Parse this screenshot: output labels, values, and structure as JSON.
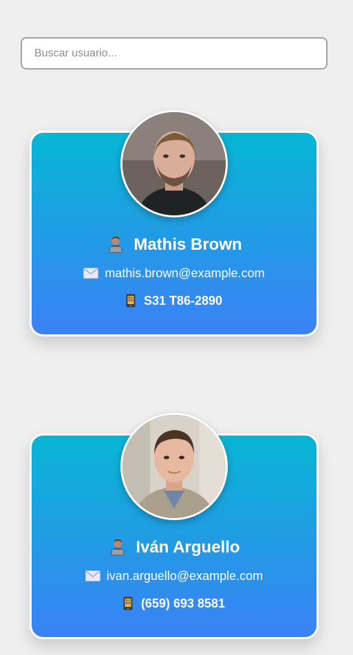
{
  "search": {
    "placeholder": "Buscar usuario..."
  },
  "users": [
    {
      "name": "Mathis Brown",
      "email": "mathis.brown@example.com",
      "phone": "S31 T86-2890",
      "name_icon": "person-at-laptop-icon",
      "email_icon": "envelope-icon",
      "phone_icon": "mobile-phone-icon"
    },
    {
      "name": "Iván Arguello",
      "email": "ivan.arguello@example.com",
      "phone": "(659) 693 8581",
      "name_icon": "person-at-laptop-icon",
      "email_icon": "envelope-icon",
      "phone_icon": "mobile-phone-icon"
    }
  ],
  "colors": {
    "background": "#efefef",
    "card_gradient_top": "#06b6d4",
    "card_gradient_bottom": "#3b82f6",
    "card_border": "#ffffff"
  }
}
